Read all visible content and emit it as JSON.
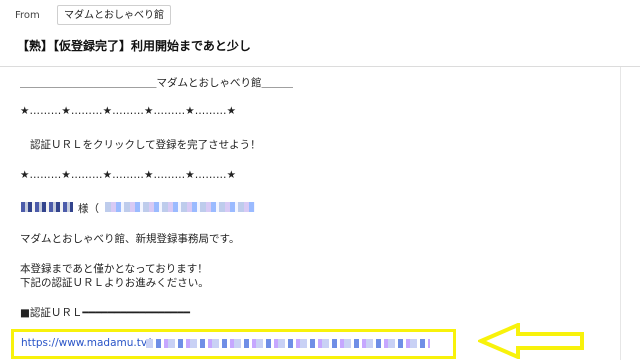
{
  "header": {
    "from_label": "From",
    "from_value": "マダムとおしゃべり館",
    "subject": "【熟】【仮登録完了】利用開始まであと少し"
  },
  "body": {
    "title_line": "＿＿＿＿＿＿＿＿＿＿＿＿＿マダムとおしゃべり館＿＿＿",
    "stars_top": "★………★………★………★………★………★",
    "instruction": "認証ＵＲＬをクリックして登録を完了させよう！",
    "stars_bottom": "★………★………★………★………★………★",
    "greeting_suffix": "様（",
    "intro": "マダムとおしゃべり館、新規登録事務局です。",
    "notice_1": "本登録まであと僅かとなっております！",
    "notice_2": "下記の認証ＵＲＬよりお進みください。",
    "url_label": "■認証ＵＲＬ━━━━━━━━━━━━━━━━━",
    "url_visible": "https://www.madamu.tv/r"
  },
  "colors": {
    "link": "#2a55c8",
    "highlight": "#f8f20b"
  },
  "icons": {
    "pointer_arrow": "yellow-left-arrow-icon"
  }
}
